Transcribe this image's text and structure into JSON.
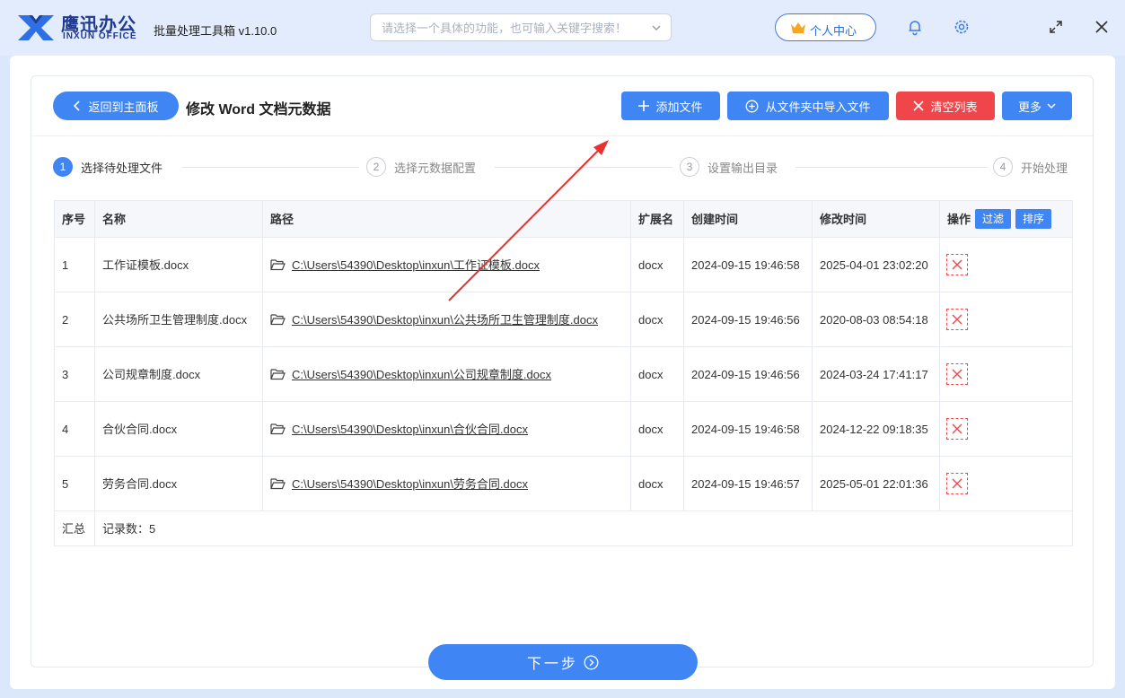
{
  "app": {
    "brand_cn": "鹰迅办公",
    "brand_en": "INXUN OFFICE",
    "title": "批量处理工具箱 v1.10.0"
  },
  "search": {
    "placeholder": "请选择一个具体的功能，也可输入关键字搜索！"
  },
  "personal_center": "个人中心",
  "toolbar": {
    "back_label": "返回到主面板",
    "page_title": "修改 Word 文档元数据",
    "add_file": "添加文件",
    "import_folder": "从文件夹中导入文件",
    "clear_list": "清空列表",
    "more": "更多"
  },
  "steps": [
    {
      "num": "1",
      "label": "选择待处理文件"
    },
    {
      "num": "2",
      "label": "选择元数据配置"
    },
    {
      "num": "3",
      "label": "设置输出目录"
    },
    {
      "num": "4",
      "label": "开始处理"
    }
  ],
  "table": {
    "headers": {
      "index": "序号",
      "name": "名称",
      "path": "路径",
      "ext": "扩展名",
      "created": "创建时间",
      "modified": "修改时间",
      "ops": "操作"
    },
    "filter_label": "过滤",
    "sort_label": "排序",
    "rows": [
      {
        "index": "1",
        "name": "工作证模板.docx",
        "path": "C:\\Users\\54390\\Desktop\\inxun\\工作证模板.docx",
        "ext": "docx",
        "created": "2024-09-15 19:46:58",
        "modified": "2025-04-01 23:02:20"
      },
      {
        "index": "2",
        "name": "公共场所卫生管理制度.docx",
        "path": "C:\\Users\\54390\\Desktop\\inxun\\公共场所卫生管理制度.docx",
        "ext": "docx",
        "created": "2024-09-15 19:46:56",
        "modified": "2020-08-03 08:54:18"
      },
      {
        "index": "3",
        "name": "公司规章制度.docx",
        "path": "C:\\Users\\54390\\Desktop\\inxun\\公司规章制度.docx",
        "ext": "docx",
        "created": "2024-09-15 19:46:56",
        "modified": "2024-03-24 17:41:17"
      },
      {
        "index": "4",
        "name": "合伙合同.docx",
        "path": "C:\\Users\\54390\\Desktop\\inxun\\合伙合同.docx",
        "ext": "docx",
        "created": "2024-09-15 19:46:58",
        "modified": "2024-12-22 09:18:35"
      },
      {
        "index": "5",
        "name": "劳务合同.docx",
        "path": "C:\\Users\\54390\\Desktop\\inxun\\劳务合同.docx",
        "ext": "docx",
        "created": "2024-09-15 19:46:57",
        "modified": "2025-05-01 22:01:36"
      }
    ],
    "summary": {
      "label": "汇总",
      "count_text": "记录数：5"
    }
  },
  "next_label": "下一步",
  "colors": {
    "primary": "#3f85f3",
    "danger": "#f0464b",
    "arrow": "#e8322e"
  }
}
